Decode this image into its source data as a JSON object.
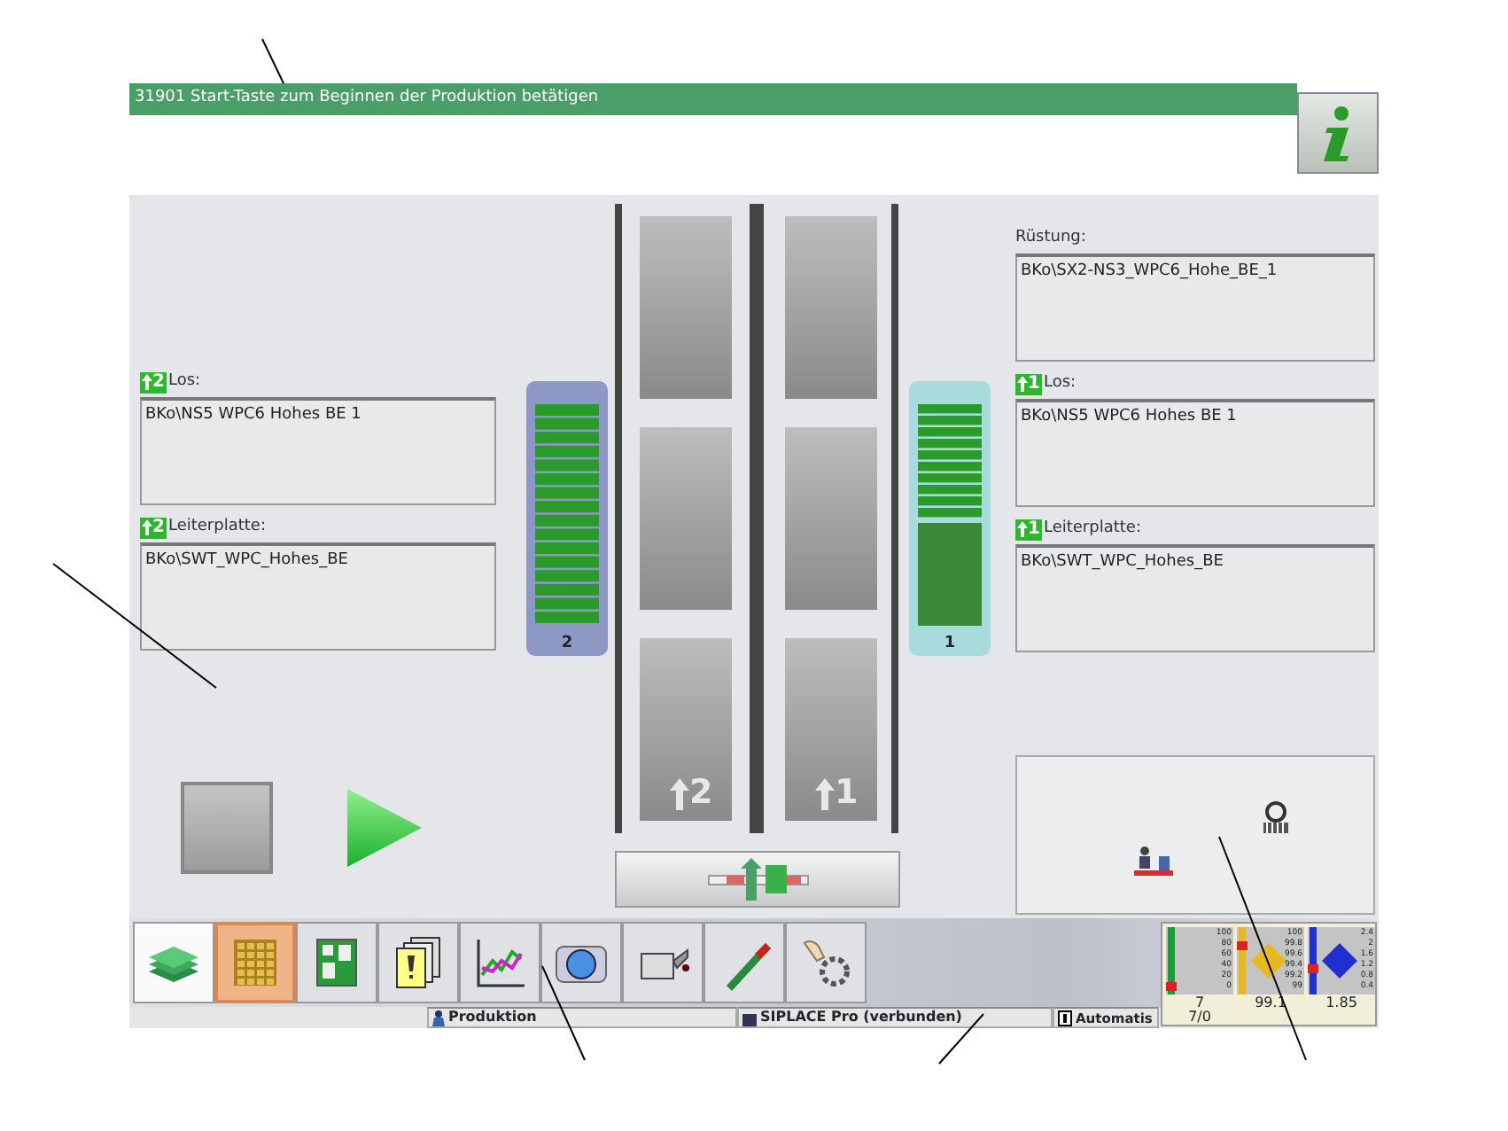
{
  "message_bar": {
    "text": "31901 Start-Taste zum Beginnen der Produktion betätigen"
  },
  "left_panel": {
    "fields": [
      {
        "label": "Los:",
        "badge": "2",
        "value": "BKo\\NS5 WPC6 Hohes BE 1"
      },
      {
        "label": "Leiterplatte:",
        "badge": "2",
        "value": "BKo\\SWT_WPC_Hohes_BE"
      }
    ]
  },
  "machine": {
    "feeder_tables": [
      {
        "label": "2"
      },
      {
        "label": "1"
      }
    ],
    "lanes": [
      {
        "label": "2"
      },
      {
        "label": "1"
      }
    ]
  },
  "right_panel": {
    "fields": [
      {
        "label": "Rüstung:",
        "value": "BKo\\SX2-NS3_WPC6_Hohe_BE_1"
      },
      {
        "label": "Los:",
        "badge": "1",
        "value": "BKo\\NS5 WPC6 Hohes BE 1"
      },
      {
        "label": "Leiterplatte:",
        "badge": "1",
        "value": "BKo\\SWT_WPC_Hohes_BE"
      }
    ]
  },
  "toolbar": {
    "buttons": [
      {
        "kind": "boards",
        "selected": true,
        "highlighted": false
      },
      {
        "kind": "grid",
        "selected": false,
        "highlighted": true
      },
      {
        "kind": "layout",
        "selected": false,
        "highlighted": false
      },
      {
        "kind": "documents",
        "selected": false,
        "highlighted": false
      },
      {
        "kind": "chart",
        "selected": false,
        "highlighted": false
      },
      {
        "kind": "camera",
        "selected": false,
        "highlighted": false
      },
      {
        "kind": "oilcan",
        "selected": false,
        "highlighted": false
      },
      {
        "kind": "nozzle",
        "selected": false,
        "highlighted": false
      },
      {
        "kind": "service",
        "selected": false,
        "highlighted": false
      }
    ]
  },
  "gauges": [
    {
      "color": "#1a9a3a",
      "level": 0.05,
      "scale": [
        "100",
        "80",
        "60",
        "40",
        "20",
        "0"
      ],
      "reading": "7",
      "sub": "7/0"
    },
    {
      "color": "#e8b820",
      "level": 0.75,
      "scale": [
        "100",
        "99.8",
        "99.6",
        "99.4",
        "99.2",
        "99"
      ],
      "reading": "99.1"
    },
    {
      "color": "#2030d0",
      "level": 0.35,
      "scale": [
        "2.4",
        "2",
        "1.6",
        "1.2",
        "0.8",
        "0.4"
      ],
      "reading": "1.85"
    }
  ],
  "status_bar": [
    {
      "kind": "user",
      "text": "Produktion"
    },
    {
      "kind": "server",
      "text": "SIPLACE Pro (verbunden)"
    },
    {
      "kind": "mode",
      "text": "Automatis"
    }
  ]
}
